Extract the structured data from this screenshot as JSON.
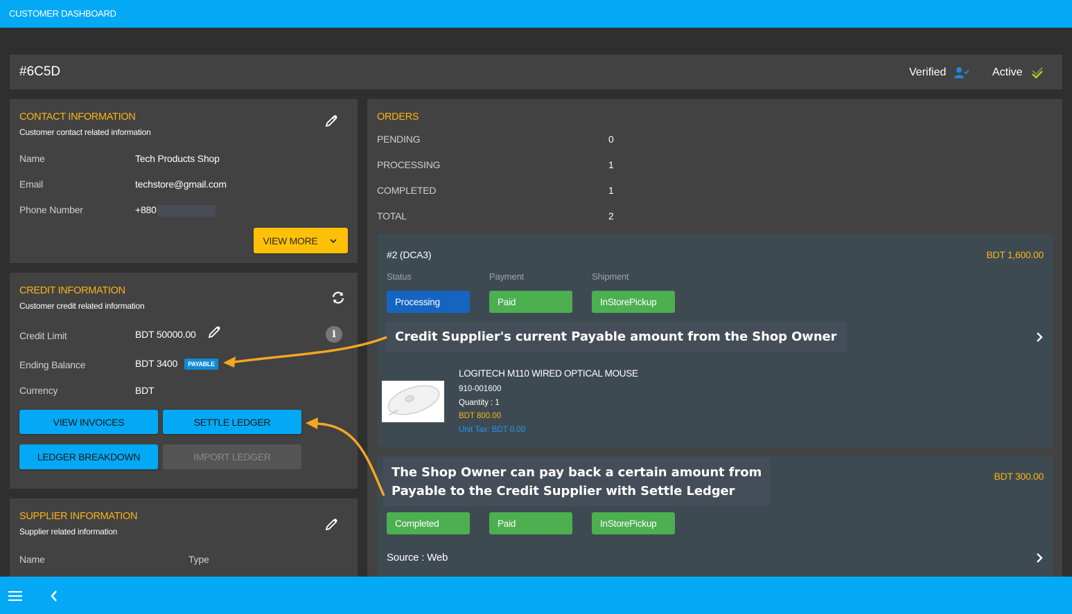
{
  "app": {
    "title": "CUSTOMER DASHBOARD"
  },
  "header": {
    "customer_id": "#6C5D",
    "verified_label": "Verified",
    "active_label": "Active"
  },
  "contact": {
    "title": "CONTACT INFORMATION",
    "subtitle": "Customer contact related information",
    "rows": [
      {
        "label": "Name",
        "value": "Tech Products Shop"
      },
      {
        "label": "Email",
        "value": "techstore@gmail.com"
      },
      {
        "label": "Phone Number",
        "value": "+880"
      }
    ],
    "view_more_label": "VIEW MORE"
  },
  "credit": {
    "title": "CREDIT INFORMATION",
    "subtitle": "Customer credit related information",
    "rows": [
      {
        "label": "Credit Limit",
        "value": "BDT 50000.00"
      },
      {
        "label": "Ending Balance",
        "value": "BDT 3400",
        "badge": "PAYABLE"
      },
      {
        "label": "Currency",
        "value": "BDT"
      }
    ],
    "buttons": {
      "view_invoices": "VIEW INVOICES",
      "settle_ledger": "SETTLE LEDGER",
      "ledger_breakdown": "LEDGER BREAKDOWN",
      "import_ledger": "IMPORT LEDGER"
    }
  },
  "supplier": {
    "title": "SUPPLIER INFORMATION",
    "subtitle": "Supplier related information",
    "columns": [
      "Name",
      "Type"
    ]
  },
  "orders": {
    "title": "ORDERS",
    "stats": [
      {
        "label": "PENDING",
        "count": "0"
      },
      {
        "label": "PROCESSING",
        "count": "1"
      },
      {
        "label": "COMPLETED",
        "count": "1"
      },
      {
        "label": "TOTAL",
        "count": "2"
      }
    ],
    "col_labels": {
      "status": "Status",
      "payment": "Payment",
      "shipment": "Shipment"
    },
    "list": [
      {
        "id": "#2 (DCA3)",
        "amount": "BDT 1,600.00",
        "status": "Processing",
        "payment": "Paid",
        "shipment": "InStorePickup",
        "item": {
          "name": "LOGITECH M110 WIRED OPTICAL MOUSE",
          "sku": "910-001600",
          "quantity": "Quantity : 1",
          "price": "BDT 800.00",
          "unit_tax": "Unit Tax: BDT 0.00"
        }
      },
      {
        "amount": "BDT 300.00",
        "status": "Completed",
        "payment": "Paid",
        "shipment": "InStorePickup",
        "source": "Source : Web"
      }
    ]
  },
  "annotations": {
    "callout_payable": "Credit Supplier's current Payable amount from the Shop Owner",
    "callout_settle_line1": "The Shop Owner can pay back a certain amount from",
    "callout_settle_line2": "Payable to the Credit Supplier with Settle Ledger"
  },
  "colors": {
    "primary": "#03a9f4",
    "accent": "#fbb418",
    "processing": "#1565c0",
    "success": "#4caf50",
    "verified_icon": "#1e88e5",
    "active_icon": "#b5e61d",
    "arrow": "#f5a623"
  }
}
